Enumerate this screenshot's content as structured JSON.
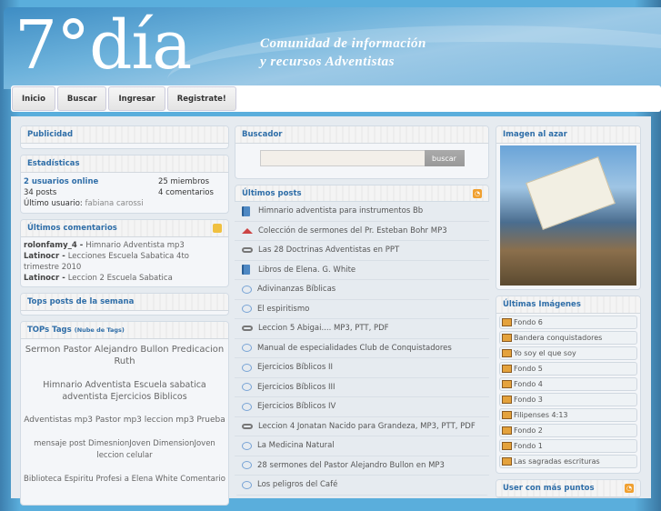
{
  "header": {
    "logo": "7°día",
    "tagline_1": "Comunidad de información",
    "tagline_2": "y recursos Adventistas"
  },
  "nav": [
    "Inicio",
    "Buscar",
    "Ingresar",
    "Registrate!"
  ],
  "left": {
    "publicidad": "Publicidad",
    "stats": {
      "title": "Estadísticas",
      "online": "2 usuarios online",
      "members": "25 miembros",
      "posts": "34 posts",
      "comments": "4 comentarios",
      "last_user_label": "Último usuario:",
      "last_user": "fabiana carossi"
    },
    "comments": {
      "title": "Últimos comentarios",
      "items": [
        {
          "user": "rolonfamy_4",
          "text": "Himnario Adventista mp3"
        },
        {
          "user": "Latinocr",
          "text": "Lecciones Escuela Sabatica 4to trimestre 2010"
        },
        {
          "user": "Latinocr",
          "text": "Leccion 2 Escuela Sabatica"
        }
      ]
    },
    "tops": "Tops posts de la semana",
    "tags": {
      "title": "TOPs Tags",
      "subtitle": "(Nube de Tags)",
      "groups": [
        "Sermon Pastor Alejandro Bullon Predicacion Ruth",
        "Himnario Adventista Escuela sabatica adventista Ejercicios Biblicos",
        "Adventistas mp3 Pastor mp3 leccion mp3 Prueba",
        "mensaje post DimesnionJoven DimensionJoven leccion celular",
        "Biblioteca Espiritu Profesi a Elena White Comentario"
      ]
    }
  },
  "center": {
    "search": {
      "title": "Buscador",
      "button": "buscar",
      "value": ""
    },
    "posts": {
      "title": "Últimos posts",
      "items": [
        {
          "icon": "book",
          "title": "Himnario adventista para instrumentos Bb"
        },
        {
          "icon": "house",
          "title": "Colección de sermones del Pr. Esteban Bohr MP3"
        },
        {
          "icon": "link",
          "title": "Las 28 Doctrinas Adventistas en PPT"
        },
        {
          "icon": "book",
          "title": "Libros de Elena. G. White"
        },
        {
          "icon": "chat",
          "title": "Adivinanzas Bíblicas"
        },
        {
          "icon": "chat",
          "title": "El espiritismo"
        },
        {
          "icon": "link",
          "title": "Leccion 5 Abigai.... MP3, PTT, PDF"
        },
        {
          "icon": "chat",
          "title": "Manual de especialidades Club de Conquistadores"
        },
        {
          "icon": "chat",
          "title": "Ejercicios Bíblicos II"
        },
        {
          "icon": "chat",
          "title": "Ejercicios Bíblicos III"
        },
        {
          "icon": "chat",
          "title": "Ejercicios Bíblicos IV"
        },
        {
          "icon": "link",
          "title": "Leccion 4 Jonatan Nacido para Grandeza, MP3, PTT, PDF"
        },
        {
          "icon": "chat",
          "title": "La Medicina Natural"
        },
        {
          "icon": "chat",
          "title": "28 sermones del Pastor Alejandro Bullon en MP3"
        },
        {
          "icon": "chat",
          "title": "Los peligros del Café"
        }
      ]
    }
  },
  "right": {
    "random": "Imagen al azar",
    "images": {
      "title": "Últimas Imágenes",
      "items": [
        "Fondo 6",
        "Bandera conquistadores",
        "Yo soy el que soy",
        "Fondo 5",
        "Fondo 4",
        "Fondo 3",
        "Filipenses 4:13",
        "Fondo 2",
        "Fondo 1",
        "Las sagradas escrituras"
      ]
    },
    "points": "User con más puntos"
  }
}
